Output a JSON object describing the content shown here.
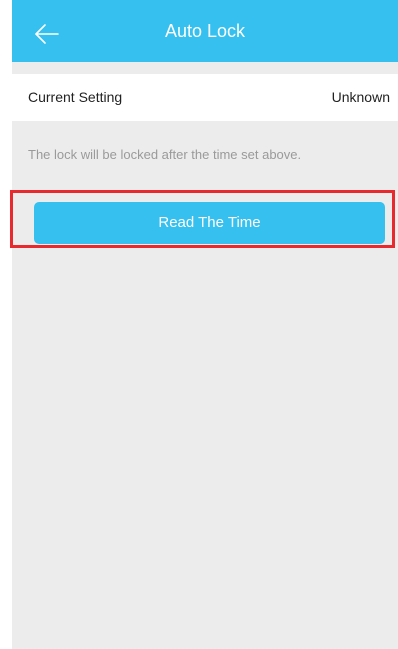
{
  "header": {
    "title": "Auto Lock",
    "back_icon": "arrow-left-icon"
  },
  "setting": {
    "label": "Current Setting",
    "value": "Unknown"
  },
  "hint": "The lock will be locked after the time set above.",
  "action": {
    "read_label": "Read The Time"
  },
  "colors": {
    "header_bg": "#35c0ef",
    "button_bg": "#35c0ef",
    "highlight": "#e8292d",
    "page_bg": "#ececec"
  }
}
